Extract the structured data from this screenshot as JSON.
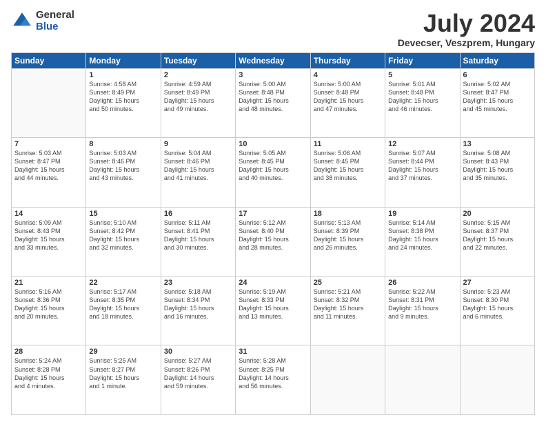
{
  "logo": {
    "general": "General",
    "blue": "Blue"
  },
  "title": "July 2024",
  "location": "Devecser, Veszprem, Hungary",
  "weekdays": [
    "Sunday",
    "Monday",
    "Tuesday",
    "Wednesday",
    "Thursday",
    "Friday",
    "Saturday"
  ],
  "weeks": [
    [
      {
        "day": "",
        "info": ""
      },
      {
        "day": "1",
        "info": "Sunrise: 4:58 AM\nSunset: 8:49 PM\nDaylight: 15 hours\nand 50 minutes."
      },
      {
        "day": "2",
        "info": "Sunrise: 4:59 AM\nSunset: 8:49 PM\nDaylight: 15 hours\nand 49 minutes."
      },
      {
        "day": "3",
        "info": "Sunrise: 5:00 AM\nSunset: 8:48 PM\nDaylight: 15 hours\nand 48 minutes."
      },
      {
        "day": "4",
        "info": "Sunrise: 5:00 AM\nSunset: 8:48 PM\nDaylight: 15 hours\nand 47 minutes."
      },
      {
        "day": "5",
        "info": "Sunrise: 5:01 AM\nSunset: 8:48 PM\nDaylight: 15 hours\nand 46 minutes."
      },
      {
        "day": "6",
        "info": "Sunrise: 5:02 AM\nSunset: 8:47 PM\nDaylight: 15 hours\nand 45 minutes."
      }
    ],
    [
      {
        "day": "7",
        "info": "Sunrise: 5:03 AM\nSunset: 8:47 PM\nDaylight: 15 hours\nand 44 minutes."
      },
      {
        "day": "8",
        "info": "Sunrise: 5:03 AM\nSunset: 8:46 PM\nDaylight: 15 hours\nand 43 minutes."
      },
      {
        "day": "9",
        "info": "Sunrise: 5:04 AM\nSunset: 8:46 PM\nDaylight: 15 hours\nand 41 minutes."
      },
      {
        "day": "10",
        "info": "Sunrise: 5:05 AM\nSunset: 8:45 PM\nDaylight: 15 hours\nand 40 minutes."
      },
      {
        "day": "11",
        "info": "Sunrise: 5:06 AM\nSunset: 8:45 PM\nDaylight: 15 hours\nand 38 minutes."
      },
      {
        "day": "12",
        "info": "Sunrise: 5:07 AM\nSunset: 8:44 PM\nDaylight: 15 hours\nand 37 minutes."
      },
      {
        "day": "13",
        "info": "Sunrise: 5:08 AM\nSunset: 8:43 PM\nDaylight: 15 hours\nand 35 minutes."
      }
    ],
    [
      {
        "day": "14",
        "info": "Sunrise: 5:09 AM\nSunset: 8:43 PM\nDaylight: 15 hours\nand 33 minutes."
      },
      {
        "day": "15",
        "info": "Sunrise: 5:10 AM\nSunset: 8:42 PM\nDaylight: 15 hours\nand 32 minutes."
      },
      {
        "day": "16",
        "info": "Sunrise: 5:11 AM\nSunset: 8:41 PM\nDaylight: 15 hours\nand 30 minutes."
      },
      {
        "day": "17",
        "info": "Sunrise: 5:12 AM\nSunset: 8:40 PM\nDaylight: 15 hours\nand 28 minutes."
      },
      {
        "day": "18",
        "info": "Sunrise: 5:13 AM\nSunset: 8:39 PM\nDaylight: 15 hours\nand 26 minutes."
      },
      {
        "day": "19",
        "info": "Sunrise: 5:14 AM\nSunset: 8:38 PM\nDaylight: 15 hours\nand 24 minutes."
      },
      {
        "day": "20",
        "info": "Sunrise: 5:15 AM\nSunset: 8:37 PM\nDaylight: 15 hours\nand 22 minutes."
      }
    ],
    [
      {
        "day": "21",
        "info": "Sunrise: 5:16 AM\nSunset: 8:36 PM\nDaylight: 15 hours\nand 20 minutes."
      },
      {
        "day": "22",
        "info": "Sunrise: 5:17 AM\nSunset: 8:35 PM\nDaylight: 15 hours\nand 18 minutes."
      },
      {
        "day": "23",
        "info": "Sunrise: 5:18 AM\nSunset: 8:34 PM\nDaylight: 15 hours\nand 16 minutes."
      },
      {
        "day": "24",
        "info": "Sunrise: 5:19 AM\nSunset: 8:33 PM\nDaylight: 15 hours\nand 13 minutes."
      },
      {
        "day": "25",
        "info": "Sunrise: 5:21 AM\nSunset: 8:32 PM\nDaylight: 15 hours\nand 11 minutes."
      },
      {
        "day": "26",
        "info": "Sunrise: 5:22 AM\nSunset: 8:31 PM\nDaylight: 15 hours\nand 9 minutes."
      },
      {
        "day": "27",
        "info": "Sunrise: 5:23 AM\nSunset: 8:30 PM\nDaylight: 15 hours\nand 6 minutes."
      }
    ],
    [
      {
        "day": "28",
        "info": "Sunrise: 5:24 AM\nSunset: 8:28 PM\nDaylight: 15 hours\nand 4 minutes."
      },
      {
        "day": "29",
        "info": "Sunrise: 5:25 AM\nSunset: 8:27 PM\nDaylight: 15 hours\nand 1 minute."
      },
      {
        "day": "30",
        "info": "Sunrise: 5:27 AM\nSunset: 8:26 PM\nDaylight: 14 hours\nand 59 minutes."
      },
      {
        "day": "31",
        "info": "Sunrise: 5:28 AM\nSunset: 8:25 PM\nDaylight: 14 hours\nand 56 minutes."
      },
      {
        "day": "",
        "info": ""
      },
      {
        "day": "",
        "info": ""
      },
      {
        "day": "",
        "info": ""
      }
    ]
  ]
}
